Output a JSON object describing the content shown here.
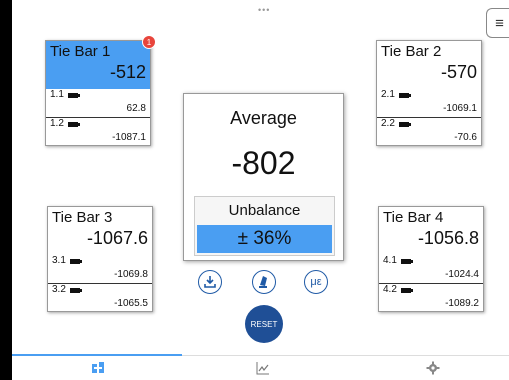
{
  "tie_bars": [
    {
      "name": "Tie Bar 1",
      "value": "-512",
      "active": true,
      "badge": "1",
      "sensors": [
        {
          "id": "1.1",
          "value": "62.8"
        },
        {
          "id": "1.2",
          "value": "-1087.1"
        }
      ]
    },
    {
      "name": "Tie Bar 2",
      "value": "-570",
      "active": false,
      "sensors": [
        {
          "id": "2.1",
          "value": "-1069.1"
        },
        {
          "id": "2.2",
          "value": "-70.6"
        }
      ]
    },
    {
      "name": "Tie Bar 3",
      "value": "-1067.6",
      "active": false,
      "sensors": [
        {
          "id": "3.1",
          "value": "-1069.8"
        },
        {
          "id": "3.2",
          "value": "-1065.5"
        }
      ]
    },
    {
      "name": "Tie Bar 4",
      "value": "-1056.8",
      "active": false,
      "sensors": [
        {
          "id": "4.1",
          "value": "-1024.4"
        },
        {
          "id": "4.2",
          "value": "-1089.2"
        }
      ]
    }
  ],
  "average": {
    "label": "Average",
    "value": "-802"
  },
  "unbalance": {
    "label": "Unbalance",
    "value": "± 36%"
  },
  "actions": {
    "strain_label": "με",
    "reset_label": "RESET"
  },
  "tabs": [
    {
      "icon": "tie-bar-icon",
      "active": true
    },
    {
      "icon": "chart-icon",
      "active": false
    },
    {
      "icon": "gear-icon",
      "active": false
    }
  ],
  "colors": {
    "accent": "#4a9ef2",
    "primary": "#1f4f96",
    "badge": "#e8453c"
  }
}
